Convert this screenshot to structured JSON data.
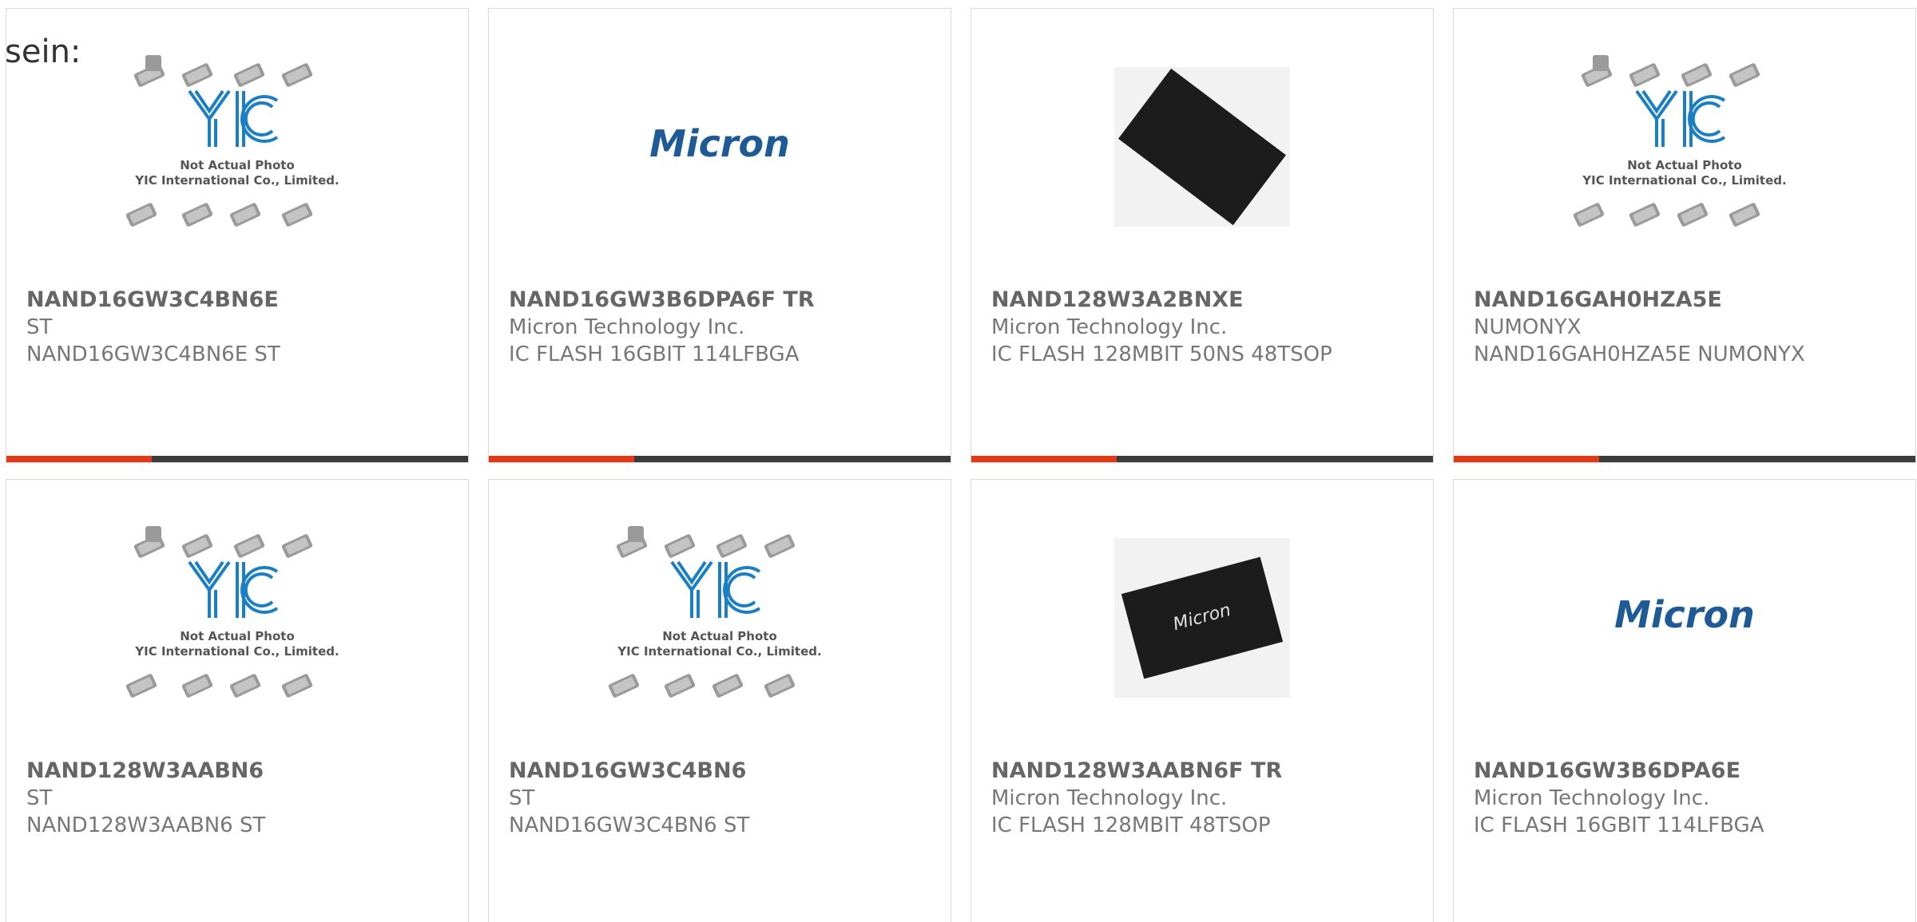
{
  "intro_text": "sein:",
  "placeholder_image": {
    "caption_line1": "Not Actual Photo",
    "caption_line2": "YIC International Co., Limited.",
    "logo_text": "YIC"
  },
  "micron_logo_text": "Micron",
  "colors": {
    "accent": "#e63814",
    "bar": "#3b3b3b",
    "yic_blue": "#1a7fc4",
    "micron_blue": "#1d5a96",
    "text_gray": "#666666"
  },
  "products": [
    {
      "part_number": "NAND16GW3C4BN6E",
      "manufacturer": "ST",
      "description": "NAND16GW3C4BN6E ST",
      "image": "yic-placeholder"
    },
    {
      "part_number": "NAND16GW3B6DPA6F TR",
      "manufacturer": "Micron Technology Inc.",
      "description": "IC FLASH 16GBIT 114LFBGA",
      "image": "micron-logo"
    },
    {
      "part_number": "NAND128W3A2BNXE",
      "manufacturer": "Micron Technology Inc.",
      "description": "IC FLASH 128MBIT 50NS 48TSOP",
      "image": "tsop-chip"
    },
    {
      "part_number": "NAND16GAH0HZA5E",
      "manufacturer": "NUMONYX",
      "description": "NAND16GAH0HZA5E NUMONYX",
      "image": "yic-placeholder"
    },
    {
      "part_number": "NAND128W3AABN6",
      "manufacturer": "ST",
      "description": "NAND128W3AABN6 ST",
      "image": "yic-placeholder"
    },
    {
      "part_number": "NAND16GW3C4BN6",
      "manufacturer": "ST",
      "description": "NAND16GW3C4BN6 ST",
      "image": "yic-placeholder"
    },
    {
      "part_number": "NAND128W3AABN6F TR",
      "manufacturer": "Micron Technology Inc.",
      "description": "IC FLASH 128MBIT 48TSOP",
      "image": "tsop-chip-micron"
    },
    {
      "part_number": "NAND16GW3B6DPA6E",
      "manufacturer": "Micron Technology Inc.",
      "description": "IC FLASH 16GBIT 114LFBGA",
      "image": "micron-logo"
    }
  ]
}
